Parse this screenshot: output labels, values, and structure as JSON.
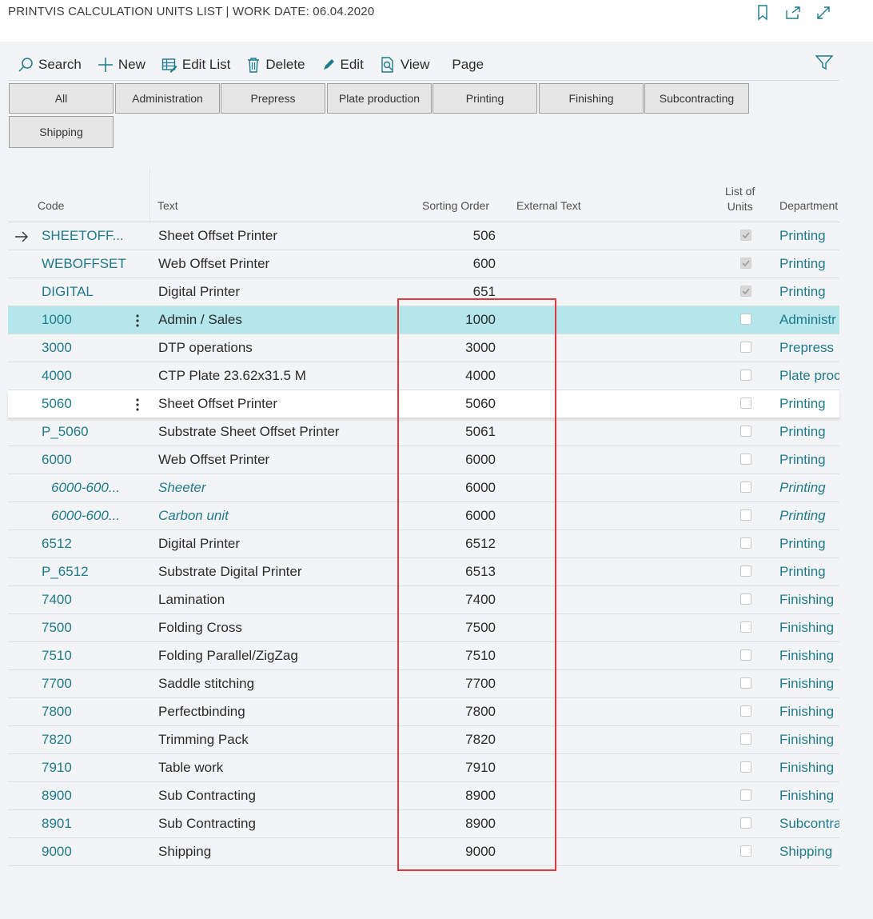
{
  "window": {
    "title": "PRINTVIS CALCULATION UNITS LIST | WORK DATE: 06.04.2020"
  },
  "titlebar_icons": [
    "bookmark-icon",
    "open-new-window-icon",
    "expand-icon"
  ],
  "actions": {
    "search": "Search",
    "new": "New",
    "edit_list": "Edit List",
    "delete": "Delete",
    "edit": "Edit",
    "view": "View",
    "page": "Page"
  },
  "tabs": [
    "All",
    "Administration",
    "Prepress",
    "Plate production",
    "Printing",
    "Finishing",
    "Subcontracting",
    "Shipping"
  ],
  "columns": {
    "code": "Code",
    "text": "Text",
    "sorting_order": "Sorting Order",
    "external_text": "External Text",
    "list_of_units_1": "List of",
    "list_of_units_2": "Units",
    "department": "Department"
  },
  "rows": [
    {
      "code": "SHEETOFF...",
      "text": "Sheet Offset Printer",
      "sort": "506",
      "list": true,
      "dept": "Printing",
      "arrow": true
    },
    {
      "code": "WEBOFFSET",
      "text": "Web Offset Printer",
      "sort": "600",
      "list": true,
      "dept": "Printing"
    },
    {
      "code": "DIGITAL",
      "text": "Digital Printer",
      "sort": "651",
      "list": true,
      "dept": "Printing"
    },
    {
      "code": "1000",
      "text": "Admin / Sales",
      "sort": "1000",
      "list": false,
      "dept": "Administr",
      "selected": true,
      "dots": true
    },
    {
      "code": "3000",
      "text": "DTP operations",
      "sort": "3000",
      "list": false,
      "dept": "Prepress"
    },
    {
      "code": "4000",
      "text": "CTP Plate 23.62x31.5 M",
      "sort": "4000",
      "list": false,
      "dept": "Plate proc"
    },
    {
      "code": "5060",
      "text": "Sheet Offset Printer",
      "sort": "5060",
      "list": false,
      "dept": "Printing",
      "focus": true,
      "dots": true
    },
    {
      "code": "P_5060",
      "text": "Substrate Sheet Offset Printer",
      "sort": "5061",
      "list": false,
      "dept": "Printing"
    },
    {
      "code": "6000",
      "text": "Web Offset Printer",
      "sort": "6000",
      "list": false,
      "dept": "Printing"
    },
    {
      "code": "6000-600...",
      "text": "Sheeter",
      "sort": "6000",
      "list": false,
      "dept": "Printing",
      "sub": true
    },
    {
      "code": "6000-600...",
      "text": "Carbon unit",
      "sort": "6000",
      "list": false,
      "dept": "Printing",
      "sub": true
    },
    {
      "code": "6512",
      "text": "Digital Printer",
      "sort": "6512",
      "list": false,
      "dept": "Printing"
    },
    {
      "code": "P_6512",
      "text": "Substrate Digital Printer",
      "sort": "6513",
      "list": false,
      "dept": "Printing"
    },
    {
      "code": "7400",
      "text": "Lamination",
      "sort": "7400",
      "list": false,
      "dept": "Finishing"
    },
    {
      "code": "7500",
      "text": "Folding Cross",
      "sort": "7500",
      "list": false,
      "dept": "Finishing"
    },
    {
      "code": "7510",
      "text": "Folding Parallel/ZigZag",
      "sort": "7510",
      "list": false,
      "dept": "Finishing"
    },
    {
      "code": "7700",
      "text": "Saddle stitching",
      "sort": "7700",
      "list": false,
      "dept": "Finishing"
    },
    {
      "code": "7800",
      "text": "Perfectbinding",
      "sort": "7800",
      "list": false,
      "dept": "Finishing"
    },
    {
      "code": "7820",
      "text": "Trimming Pack",
      "sort": "7820",
      "list": false,
      "dept": "Finishing"
    },
    {
      "code": "7910",
      "text": "Table work",
      "sort": "7910",
      "list": false,
      "dept": "Finishing"
    },
    {
      "code": "8900",
      "text": "Sub Contracting",
      "sort": "8900",
      "list": false,
      "dept": "Finishing"
    },
    {
      "code": "8901",
      "text": "Sub Contracting",
      "sort": "8900",
      "list": false,
      "dept": "Subcontra"
    },
    {
      "code": "9000",
      "text": "Shipping",
      "sort": "9000",
      "list": false,
      "dept": "Shipping"
    }
  ],
  "colors": {
    "link": "#1e7a8c",
    "selected_row": "#b4e6ec",
    "highlight_box": "#e0393e"
  }
}
